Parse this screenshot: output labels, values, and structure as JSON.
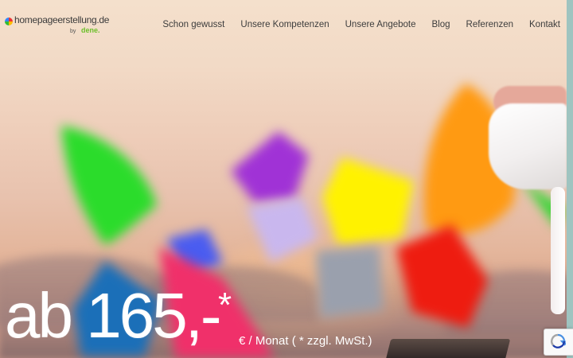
{
  "header": {
    "logo_text": "homepageerstellung.de",
    "logo_by": "by",
    "logo_brand": "dene."
  },
  "nav": {
    "items": [
      {
        "label": "Schon gewusst"
      },
      {
        "label": "Unsere Kompetenzen"
      },
      {
        "label": "Unsere Angebote"
      },
      {
        "label": "Blog"
      },
      {
        "label": "Referenzen"
      },
      {
        "label": "Kontakt"
      }
    ]
  },
  "hero": {
    "price": "ab 165,-",
    "asterisk": "*",
    "note": "€ / Monat ( * zzgl. MwSt.)"
  },
  "icons": {
    "logo": "logo-color-dot-icon",
    "recaptcha": "recaptcha-icon"
  },
  "colors": {
    "brand_green": "#6cbf2a",
    "nav_text": "#3d3d3d",
    "hero_text": "#ffffff"
  }
}
